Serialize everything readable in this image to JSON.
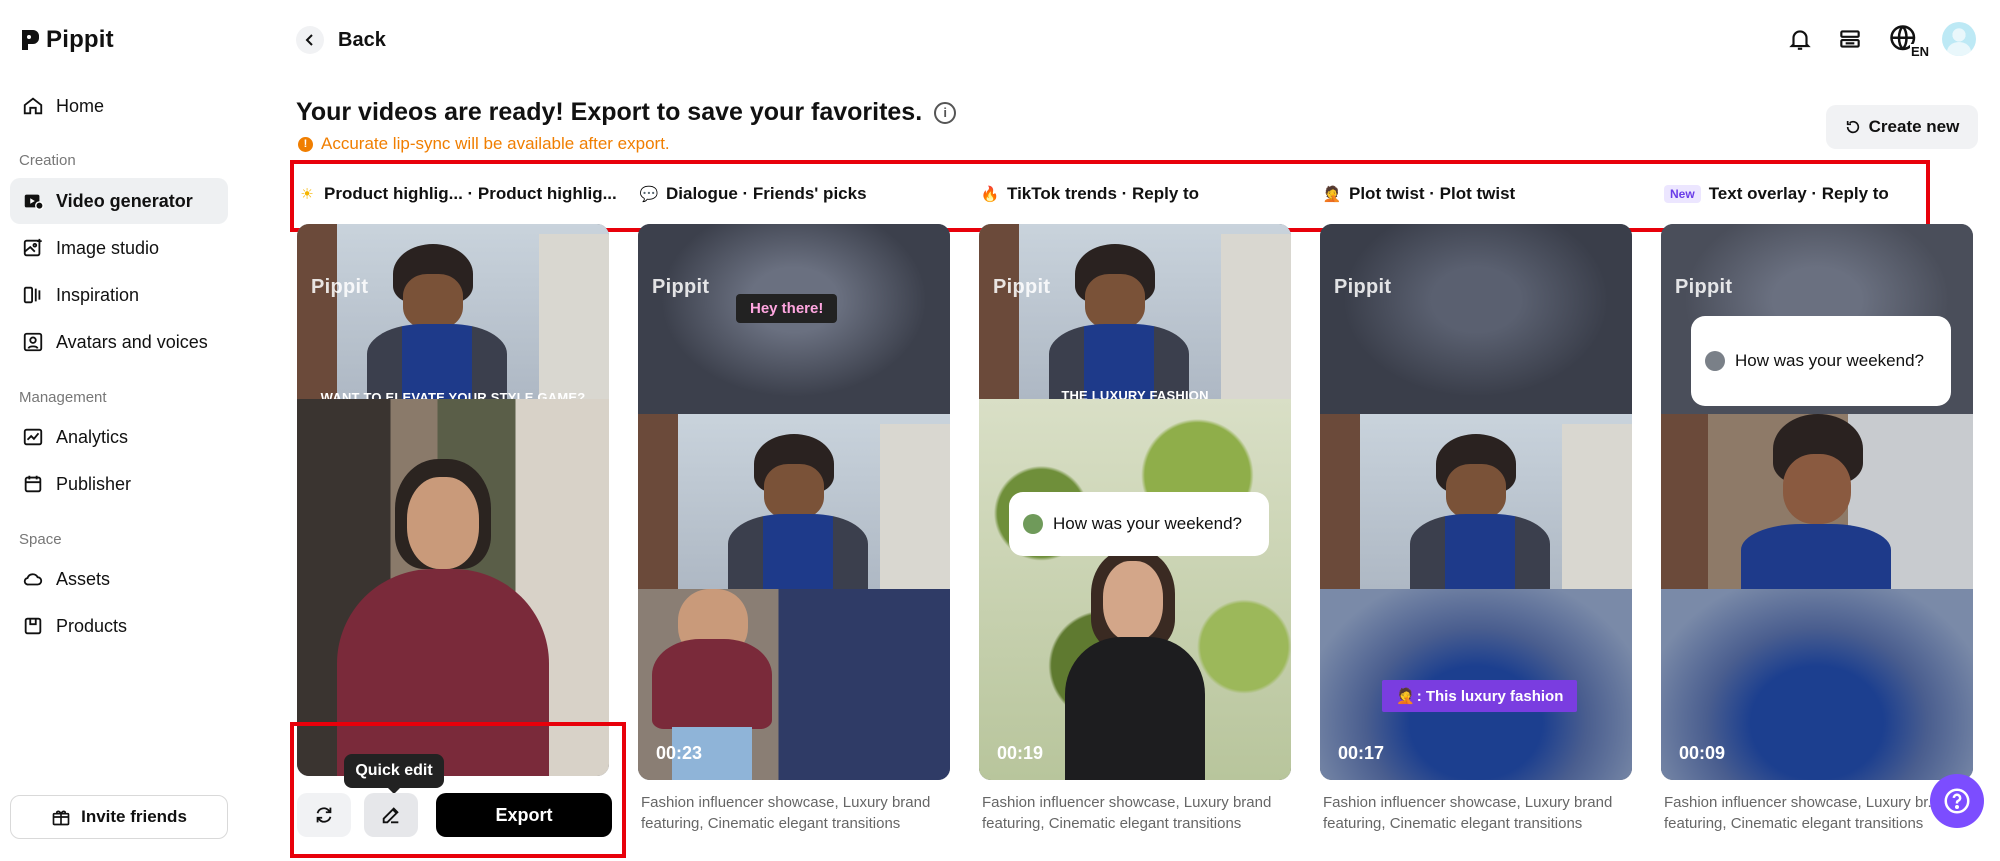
{
  "app": {
    "name": "Pippit"
  },
  "sidebar": {
    "items": [
      {
        "label": "Home",
        "icon": "home-icon"
      },
      {
        "section": "Creation"
      },
      {
        "label": "Video generator",
        "icon": "video-icon",
        "active": true
      },
      {
        "label": "Image studio",
        "icon": "image-icon"
      },
      {
        "label": "Inspiration",
        "icon": "inspiration-icon"
      },
      {
        "label": "Avatars and voices",
        "icon": "avatar-icon"
      },
      {
        "section": "Management"
      },
      {
        "label": "Analytics",
        "icon": "analytics-icon"
      },
      {
        "label": "Publisher",
        "icon": "calendar-icon"
      },
      {
        "section": "Space"
      },
      {
        "label": "Assets",
        "icon": "cloud-icon"
      },
      {
        "label": "Products",
        "icon": "box-icon"
      }
    ],
    "home": "Home",
    "creation": "Creation",
    "video_generator": "Video generator",
    "image_studio": "Image studio",
    "inspiration": "Inspiration",
    "avatars_voices": "Avatars and voices",
    "management": "Management",
    "analytics": "Analytics",
    "publisher": "Publisher",
    "space": "Space",
    "assets": "Assets",
    "products": "Products",
    "invite": "Invite friends"
  },
  "header": {
    "back": "Back",
    "lang": "EN",
    "title": "Your videos are ready! Export to save your favorites.",
    "warning": "Accurate lip-sync will be available after export.",
    "create_new": "Create new"
  },
  "tabs": [
    {
      "emoji": "☀",
      "label": "Product highlig... · Product highlig..."
    },
    {
      "emoji": "💬",
      "label": "Dialogue · Friends' picks"
    },
    {
      "emoji": "🔥",
      "label": "TikTok trends · Reply to"
    },
    {
      "emoji": "🤦",
      "label": "Plot twist · Plot twist"
    },
    {
      "badge": "New",
      "label": "Text overlay · Reply to"
    }
  ],
  "cards": [
    {
      "watermark": "Pippit",
      "caption": "WANT TO ELEVATE YOUR STYLE GAME?",
      "duration": "",
      "desc": ""
    },
    {
      "watermark": "Pippit",
      "bubble": "Hey there!",
      "duration": "00:23",
      "desc": "Fashion influencer showcase, Luxury brand featuring, Cinematic elegant transitions"
    },
    {
      "watermark": "Pippit",
      "caption": "THE LUXURY FASHION",
      "chat": "How was your weekend?",
      "duration": "00:19",
      "desc": "Fashion influencer showcase, Luxury brand featuring, Cinematic elegant transitions"
    },
    {
      "watermark": "Pippit",
      "overlay": ": This luxury fashion",
      "duration": "00:17",
      "desc": "Fashion influencer showcase, Luxury brand featuring, Cinematic elegant transitions"
    },
    {
      "watermark": "Pippit",
      "chat": "How was your weekend?",
      "duration": "00:09",
      "desc": "Fashion influencer showcase, Luxury br... featuring, Cinematic elegant transitions"
    }
  ],
  "actions": {
    "tooltip": "Quick edit",
    "export": "Export"
  },
  "colors": {
    "accent": "#7c4dff",
    "warning": "#f07e00",
    "highlight": "#e8000a"
  }
}
